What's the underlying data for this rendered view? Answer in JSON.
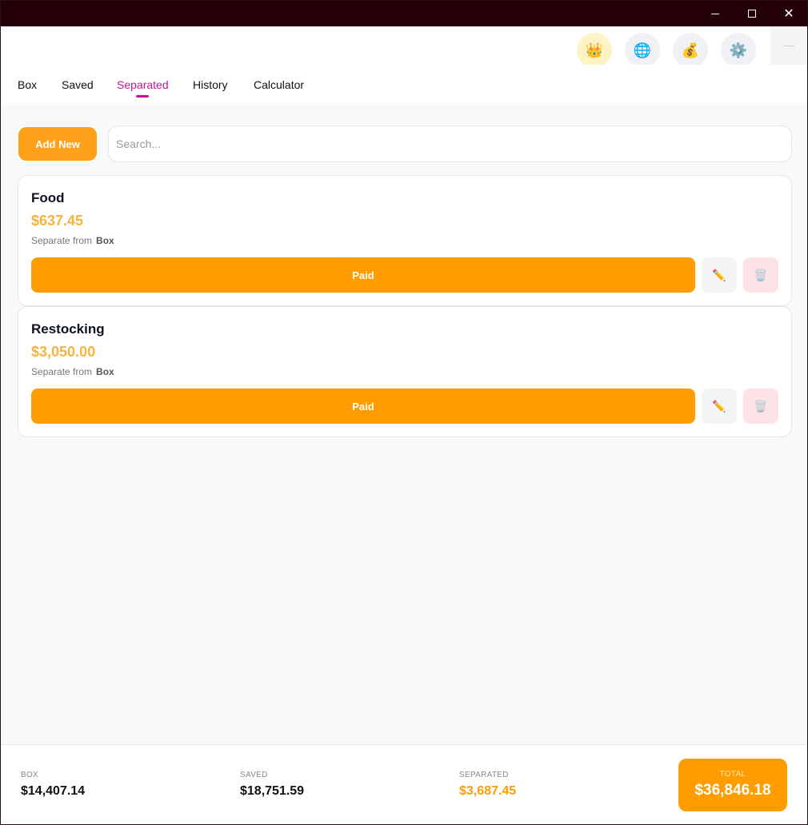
{
  "colors": {
    "titlebar": "#230005",
    "accent_orange": "#ff9c00",
    "accent_amount": "#f6b43e",
    "active_tab": "#c0149a",
    "delete_bg": "#fde3e5"
  },
  "window": {
    "controls": [
      "minimize-icon",
      "maximize-icon",
      "close-icon"
    ],
    "close_glyph": "✕"
  },
  "header": {
    "icons": {
      "crown": "👑",
      "globe": "🌐",
      "money": "💰",
      "gear": "⚙️"
    },
    "tabs": [
      {
        "label": "Box"
      },
      {
        "label": "Saved"
      },
      {
        "label": "Separated",
        "active": true
      },
      {
        "label": "History"
      },
      {
        "label": "Calculator"
      }
    ]
  },
  "toolbar": {
    "add_label": "Add New",
    "search_placeholder": "Search..."
  },
  "cards": [
    {
      "title": "Food",
      "amount": "$637.45",
      "separate_label": "Separate from",
      "source": "Box",
      "paid_label": "Paid",
      "edit_icon": "✏️",
      "delete_icon": "🗑️"
    },
    {
      "title": "Restocking",
      "amount": "$3,050.00",
      "separate_label": "Separate from",
      "source": "Box",
      "paid_label": "Paid",
      "edit_icon": "✏️",
      "delete_icon": "🗑️"
    }
  ],
  "footer": {
    "box": {
      "label": "BOX",
      "value": "$14,407.14"
    },
    "saved": {
      "label": "SAVED",
      "value": "$18,751.59"
    },
    "separated": {
      "label": "SEPARATED",
      "value": "$3,687.45"
    },
    "total": {
      "label": "TOTAL",
      "value": "$36,846.18"
    }
  }
}
